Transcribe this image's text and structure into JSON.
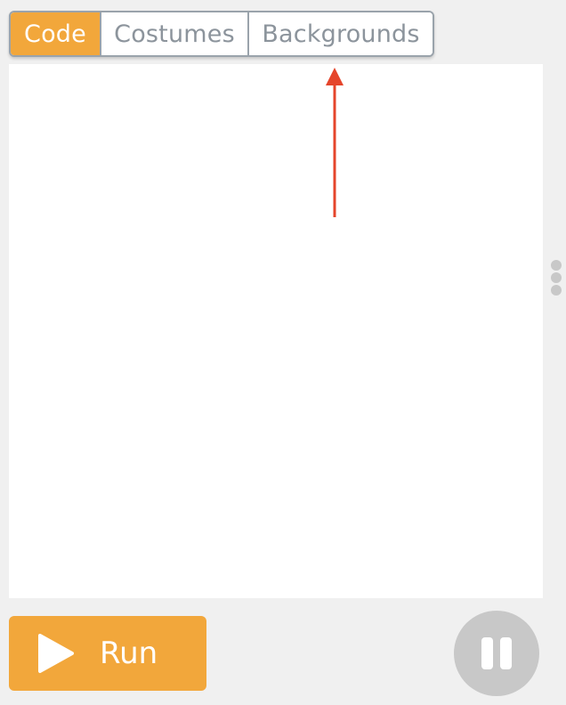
{
  "tabs": {
    "code": "Code",
    "costumes": "Costumes",
    "backgrounds": "Backgrounds",
    "active": "code"
  },
  "controls": {
    "run_label": "Run",
    "run_icon": "play-icon",
    "pause_icon": "pause-icon"
  },
  "annotation": {
    "icon": "arrow-up-icon",
    "color": "#e5452b"
  },
  "colors": {
    "accent": "#f2a73b",
    "tab_border": "#9aa3ab",
    "tab_text": "#8c949c",
    "pause_bg": "#c8c8c8",
    "background": "#f0f0f0"
  }
}
